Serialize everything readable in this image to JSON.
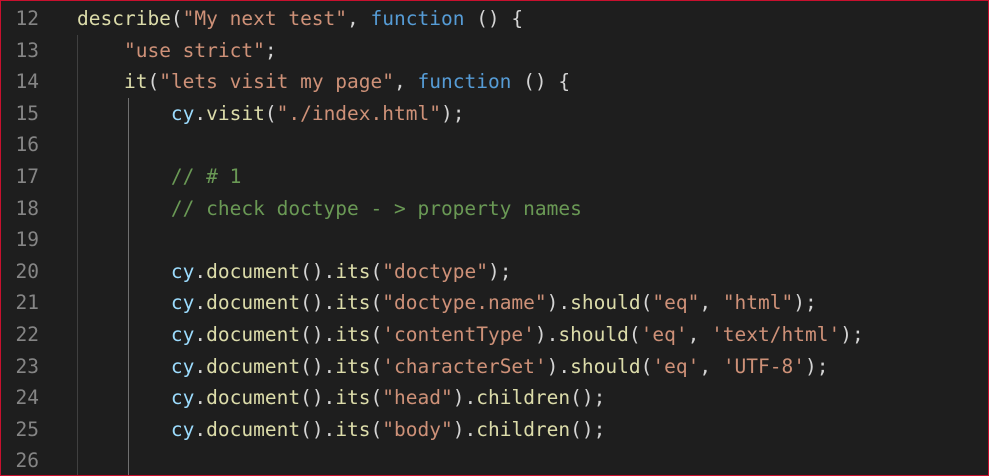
{
  "editor": {
    "colors": {
      "background": "#1e1e1e",
      "border": "#c8102e",
      "line_number": "#858585",
      "function": "#dcdcaa",
      "string": "#ce9178",
      "keyword": "#569cd6",
      "variable": "#9cdcfe",
      "comment": "#6a9955",
      "punctuation": "#d4d4d4"
    },
    "lines": [
      {
        "num": "12",
        "tokens": [
          {
            "t": "describe",
            "c": "fn"
          },
          {
            "t": "(",
            "c": "p"
          },
          {
            "t": "\"My next test\"",
            "c": "str"
          },
          {
            "t": ", ",
            "c": "p"
          },
          {
            "t": "function",
            "c": "kw"
          },
          {
            "t": " () {",
            "c": "p"
          }
        ]
      },
      {
        "num": "13",
        "tokens": [
          {
            "t": "    ",
            "c": "p"
          },
          {
            "t": "\"use strict\"",
            "c": "str"
          },
          {
            "t": ";",
            "c": "p"
          }
        ]
      },
      {
        "num": "14",
        "tokens": [
          {
            "t": "    ",
            "c": "p"
          },
          {
            "t": "it",
            "c": "fn"
          },
          {
            "t": "(",
            "c": "p"
          },
          {
            "t": "\"lets visit my page\"",
            "c": "str"
          },
          {
            "t": ", ",
            "c": "p"
          },
          {
            "t": "function",
            "c": "kw"
          },
          {
            "t": " () {",
            "c": "p"
          }
        ]
      },
      {
        "num": "15",
        "tokens": [
          {
            "t": "        ",
            "c": "p"
          },
          {
            "t": "cy",
            "c": "var"
          },
          {
            "t": ".",
            "c": "p"
          },
          {
            "t": "visit",
            "c": "fn"
          },
          {
            "t": "(",
            "c": "p"
          },
          {
            "t": "\"./index.html\"",
            "c": "str"
          },
          {
            "t": ");",
            "c": "p"
          }
        ]
      },
      {
        "num": "16",
        "tokens": []
      },
      {
        "num": "17",
        "tokens": [
          {
            "t": "        ",
            "c": "p"
          },
          {
            "t": "// # 1",
            "c": "cm"
          }
        ]
      },
      {
        "num": "18",
        "tokens": [
          {
            "t": "        ",
            "c": "p"
          },
          {
            "t": "// check doctype - > property names",
            "c": "cm"
          }
        ]
      },
      {
        "num": "19",
        "tokens": []
      },
      {
        "num": "20",
        "tokens": [
          {
            "t": "        ",
            "c": "p"
          },
          {
            "t": "cy",
            "c": "var"
          },
          {
            "t": ".",
            "c": "p"
          },
          {
            "t": "document",
            "c": "fn"
          },
          {
            "t": "().",
            "c": "p"
          },
          {
            "t": "its",
            "c": "fn"
          },
          {
            "t": "(",
            "c": "p"
          },
          {
            "t": "\"doctype\"",
            "c": "str"
          },
          {
            "t": ");",
            "c": "p"
          }
        ]
      },
      {
        "num": "21",
        "tokens": [
          {
            "t": "        ",
            "c": "p"
          },
          {
            "t": "cy",
            "c": "var"
          },
          {
            "t": ".",
            "c": "p"
          },
          {
            "t": "document",
            "c": "fn"
          },
          {
            "t": "().",
            "c": "p"
          },
          {
            "t": "its",
            "c": "fn"
          },
          {
            "t": "(",
            "c": "p"
          },
          {
            "t": "\"doctype.name\"",
            "c": "str"
          },
          {
            "t": ").",
            "c": "p"
          },
          {
            "t": "should",
            "c": "fn"
          },
          {
            "t": "(",
            "c": "p"
          },
          {
            "t": "\"eq\"",
            "c": "str"
          },
          {
            "t": ", ",
            "c": "p"
          },
          {
            "t": "\"html\"",
            "c": "str"
          },
          {
            "t": ");",
            "c": "p"
          }
        ]
      },
      {
        "num": "22",
        "tokens": [
          {
            "t": "        ",
            "c": "p"
          },
          {
            "t": "cy",
            "c": "var"
          },
          {
            "t": ".",
            "c": "p"
          },
          {
            "t": "document",
            "c": "fn"
          },
          {
            "t": "().",
            "c": "p"
          },
          {
            "t": "its",
            "c": "fn"
          },
          {
            "t": "(",
            "c": "p"
          },
          {
            "t": "'contentType'",
            "c": "str"
          },
          {
            "t": ").",
            "c": "p"
          },
          {
            "t": "should",
            "c": "fn"
          },
          {
            "t": "(",
            "c": "p"
          },
          {
            "t": "'eq'",
            "c": "str"
          },
          {
            "t": ", ",
            "c": "p"
          },
          {
            "t": "'text/html'",
            "c": "str"
          },
          {
            "t": ");",
            "c": "p"
          }
        ]
      },
      {
        "num": "23",
        "tokens": [
          {
            "t": "        ",
            "c": "p"
          },
          {
            "t": "cy",
            "c": "var"
          },
          {
            "t": ".",
            "c": "p"
          },
          {
            "t": "document",
            "c": "fn"
          },
          {
            "t": "().",
            "c": "p"
          },
          {
            "t": "its",
            "c": "fn"
          },
          {
            "t": "(",
            "c": "p"
          },
          {
            "t": "'characterSet'",
            "c": "str"
          },
          {
            "t": ").",
            "c": "p"
          },
          {
            "t": "should",
            "c": "fn"
          },
          {
            "t": "(",
            "c": "p"
          },
          {
            "t": "'eq'",
            "c": "str"
          },
          {
            "t": ", ",
            "c": "p"
          },
          {
            "t": "'UTF-8'",
            "c": "str"
          },
          {
            "t": ");",
            "c": "p"
          }
        ]
      },
      {
        "num": "24",
        "tokens": [
          {
            "t": "        ",
            "c": "p"
          },
          {
            "t": "cy",
            "c": "var"
          },
          {
            "t": ".",
            "c": "p"
          },
          {
            "t": "document",
            "c": "fn"
          },
          {
            "t": "().",
            "c": "p"
          },
          {
            "t": "its",
            "c": "fn"
          },
          {
            "t": "(",
            "c": "p"
          },
          {
            "t": "\"head\"",
            "c": "str"
          },
          {
            "t": ").",
            "c": "p"
          },
          {
            "t": "children",
            "c": "fn"
          },
          {
            "t": "();",
            "c": "p"
          }
        ]
      },
      {
        "num": "25",
        "tokens": [
          {
            "t": "        ",
            "c": "p"
          },
          {
            "t": "cy",
            "c": "var"
          },
          {
            "t": ".",
            "c": "p"
          },
          {
            "t": "document",
            "c": "fn"
          },
          {
            "t": "().",
            "c": "p"
          },
          {
            "t": "its",
            "c": "fn"
          },
          {
            "t": "(",
            "c": "p"
          },
          {
            "t": "\"body\"",
            "c": "str"
          },
          {
            "t": ").",
            "c": "p"
          },
          {
            "t": "children",
            "c": "fn"
          },
          {
            "t": "();",
            "c": "p"
          }
        ]
      },
      {
        "num": "26",
        "tokens": []
      }
    ]
  }
}
